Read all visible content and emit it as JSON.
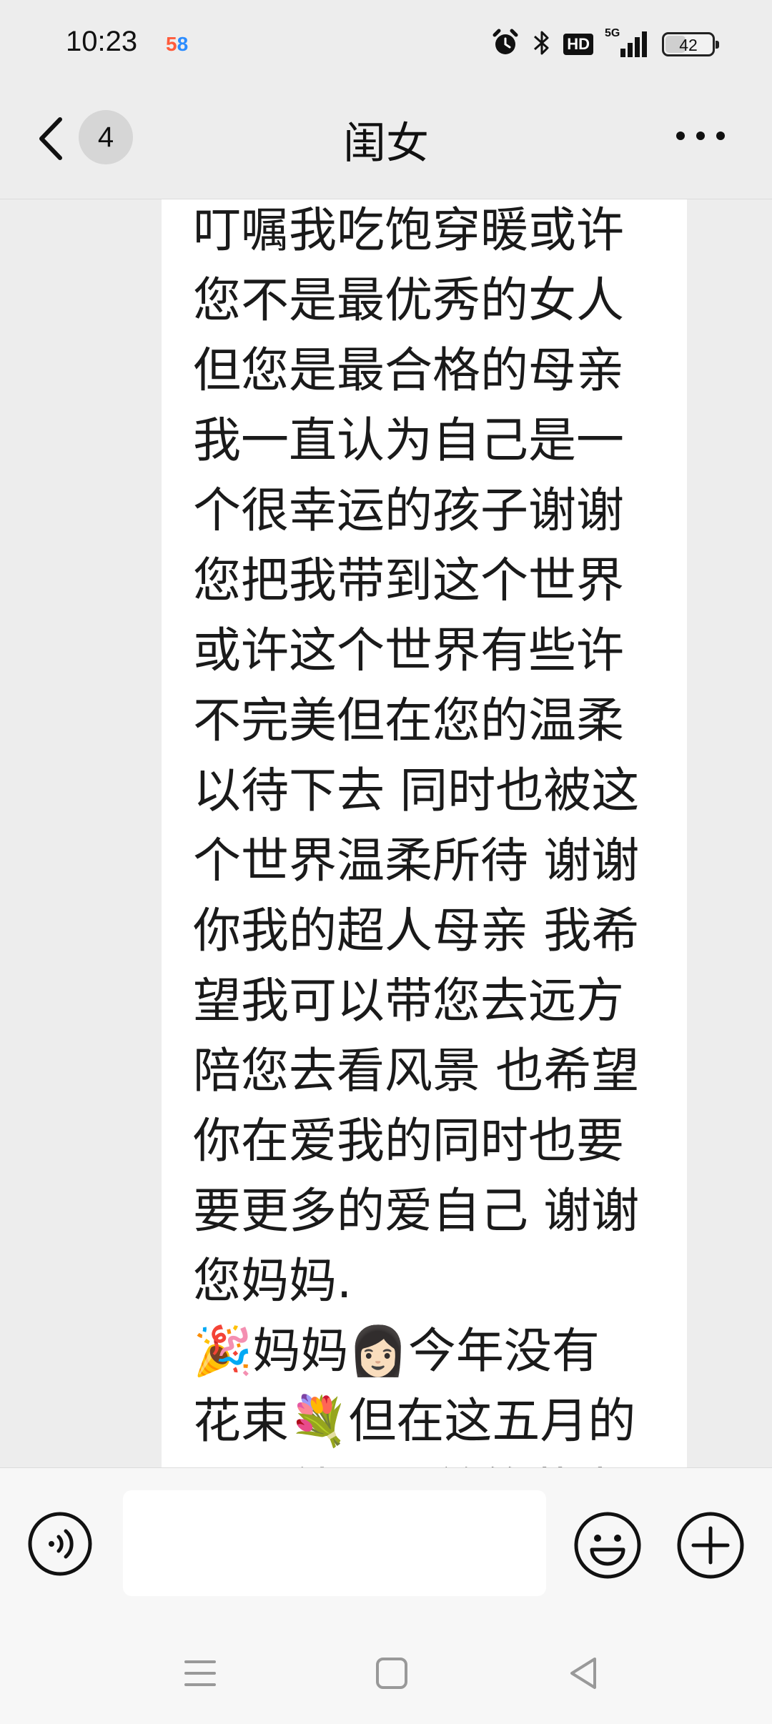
{
  "status_bar": {
    "time": "10:23",
    "app_badge": "58",
    "network": "5G",
    "hd": "HD",
    "battery_level": "42",
    "battery_fraction": 0.42
  },
  "nav": {
    "unread_count": "4",
    "title": "闺女"
  },
  "message": {
    "lines": [
      "叮嘱我吃饱穿暖或许",
      "您不是最优秀的女人",
      "但您是最合格的母亲",
      "我一直认为自己是一",
      "个很幸运的孩子谢谢",
      "您把我带到这个世界",
      "或许这个世界有些许",
      "不完美但在您的温柔",
      "以待下去 同时也被这",
      "个世界温柔所待 谢谢",
      "你我的超人母亲 我希",
      "望我可以带您去远方",
      "陪您去看风景 也希望",
      "你在爱我的同时也要",
      "要更多的爱自己 谢谢",
      "您妈妈.",
      "🎉妈妈👩🏻今年没有",
      "花束💐但在这五月的",
      "天，就是最美的花束"
    ]
  },
  "input": {
    "placeholder": ""
  },
  "icons": {
    "back": "back-arrow-icon",
    "more": "more-dots-icon",
    "voice": "voice-icon",
    "emoji": "smiley-icon",
    "plus": "plus-icon",
    "alarm": "alarm-icon",
    "bluetooth": "bluetooth-icon"
  }
}
